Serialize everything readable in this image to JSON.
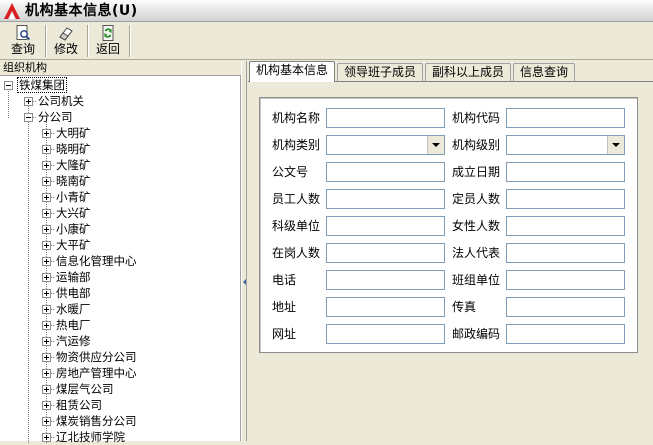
{
  "window": {
    "title": "机构基本信息(U)"
  },
  "toolbar": {
    "buttons": [
      {
        "label": "查询",
        "icon": "search-page-icon"
      },
      {
        "label": "修改",
        "icon": "eraser-icon"
      },
      {
        "label": "返回",
        "icon": "recycle-icon"
      }
    ]
  },
  "tree": {
    "header": "组织机构",
    "root": "铁煤集团",
    "level1": [
      "公司机关",
      "分公司"
    ],
    "branch_children": [
      "大明矿",
      "晓明矿",
      "大隆矿",
      "晓南矿",
      "小青矿",
      "大兴矿",
      "小康矿",
      "大平矿",
      "信息化管理中心",
      "运输部",
      "供电部",
      "水暖厂",
      "热电厂",
      "汽运修",
      "物资供应分公司",
      "房地产管理中心",
      "煤层气公司",
      "租赁公司",
      "煤炭销售分公司",
      "辽北技师学院"
    ]
  },
  "tabs": [
    "机构基本信息",
    "领导班子成员",
    "副科以上成员",
    "信息查询"
  ],
  "form": {
    "left": [
      {
        "label": "机构名称",
        "value": "",
        "type": "text"
      },
      {
        "label": "机构类别",
        "value": "",
        "type": "select"
      },
      {
        "label": "公文号",
        "value": "",
        "type": "text"
      },
      {
        "label": "员工人数",
        "value": "",
        "type": "text"
      },
      {
        "label": "科级单位",
        "value": "",
        "type": "text"
      },
      {
        "label": "在岗人数",
        "value": "",
        "type": "text"
      },
      {
        "label": "电话",
        "value": "",
        "type": "text"
      },
      {
        "label": "地址",
        "value": "",
        "type": "text"
      },
      {
        "label": "网址",
        "value": "",
        "type": "text"
      }
    ],
    "right": [
      {
        "label": "机构代码",
        "value": "",
        "type": "text"
      },
      {
        "label": "机构级别",
        "value": "",
        "type": "select"
      },
      {
        "label": "成立日期",
        "value": "",
        "type": "text"
      },
      {
        "label": "定员人数",
        "value": "",
        "type": "text"
      },
      {
        "label": "女性人数",
        "value": "",
        "type": "text"
      },
      {
        "label": "法人代表",
        "value": "",
        "type": "text"
      },
      {
        "label": "班组单位",
        "value": "",
        "type": "text"
      },
      {
        "label": "传真",
        "value": "",
        "type": "text"
      },
      {
        "label": "邮政编码",
        "value": "",
        "type": "text"
      }
    ]
  },
  "colors": {
    "window_bg": "#ece9d8",
    "input_border": "#7f9db9",
    "logo_red": "#d81e1e"
  }
}
